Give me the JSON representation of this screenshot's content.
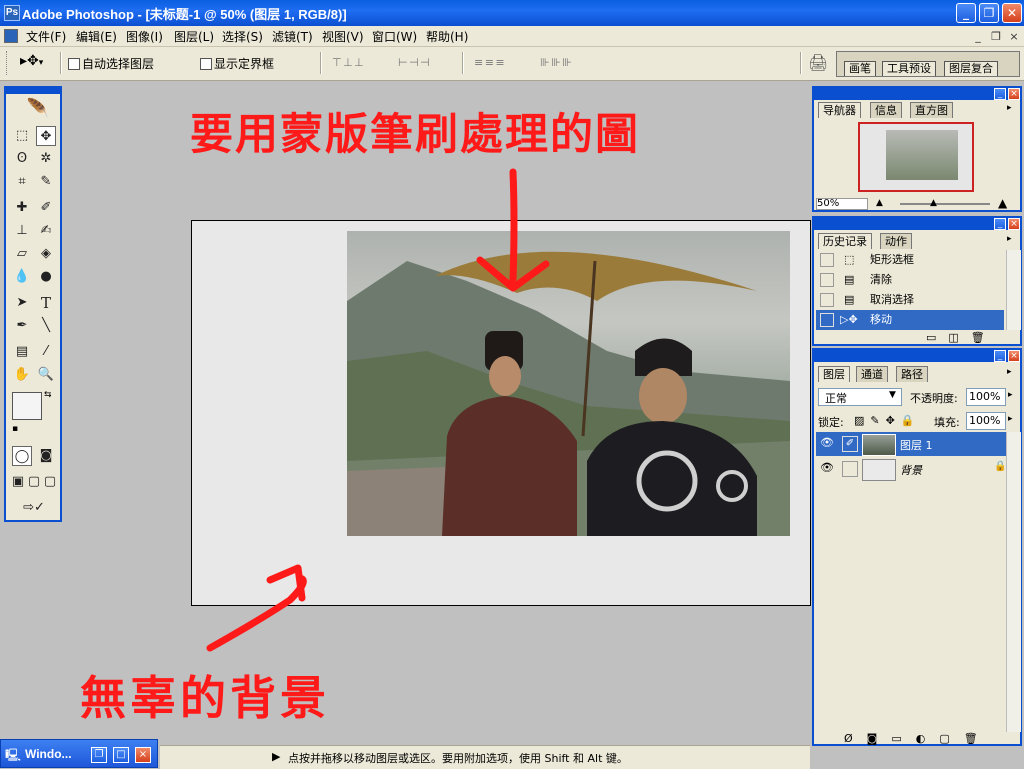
{
  "window": {
    "app_icon": "photoshop-logo",
    "title": "Adobe Photoshop - [未标题-1 @ 50% (图层 1, RGB/8)]",
    "controls": {
      "minimize": "_",
      "restore": "❐",
      "close": "✕"
    }
  },
  "menubar": {
    "items": [
      "文件(F)",
      "编辑(E)",
      "图像(I)",
      "图层(L)",
      "选择(S)",
      "滤镜(T)",
      "视图(V)",
      "窗口(W)",
      "帮助(H)"
    ],
    "doc_controls": {
      "minimize": "_",
      "restore": "❐",
      "close": "×"
    }
  },
  "options_bar": {
    "tool_icon": "move-tool-icon",
    "auto_select_label": "自动选择图层",
    "show_bounds_label": "显示定界框",
    "align_icons_1": "⊤ ⊥ ⊥",
    "align_icons_2": "⊢ ⊣ ⊣",
    "distribute_icons_1": "≡ ≡ ≡",
    "distribute_icons_2": "⊪ ⊪ ⊪",
    "palette_well_tabs": [
      "画笔",
      "工具预设",
      "图层复合"
    ]
  },
  "toolbox": {
    "tools": [
      "marquee",
      "move",
      "lasso",
      "magic-wand",
      "crop",
      "slice",
      "healing-brush",
      "brush",
      "clone-stamp",
      "history-brush",
      "eraser",
      "paint-bucket",
      "blur",
      "dodge",
      "path-select",
      "type",
      "pen",
      "line",
      "notes",
      "eyedropper",
      "hand",
      "zoom"
    ],
    "type_glyph": "T"
  },
  "annotations": {
    "top_text": "要用蒙版筆刷處理的圖",
    "bottom_text": "無辜的背景",
    "color": "#ff1a1a"
  },
  "navigator": {
    "tabs": [
      "导航器",
      "信息",
      "直方图"
    ],
    "zoom": "50%"
  },
  "history": {
    "tabs": [
      "历史记录",
      "动作"
    ],
    "items": [
      "矩形选框",
      "清除",
      "取消选择",
      "移动"
    ]
  },
  "layers": {
    "tabs": [
      "图层",
      "通道",
      "路径"
    ],
    "blend_mode": "正常",
    "opacity_label": "不透明度:",
    "opacity_value": "100%",
    "lock_label": "锁定:",
    "fill_label": "填充:",
    "fill_value": "100%",
    "items": [
      {
        "name": "图层 1"
      },
      {
        "name": "背景"
      }
    ]
  },
  "taskbar": {
    "label": "Windo..."
  },
  "status": {
    "text": "点按并拖移以移动图层或选区。要用附加选项，使用 Shift 和 Alt 键。"
  },
  "colors": {
    "titlebar": "#0a5fe0",
    "panel_bg": "#ece9d8",
    "canvas_bg": "#c0c0c0",
    "selection": "#316ac5"
  }
}
